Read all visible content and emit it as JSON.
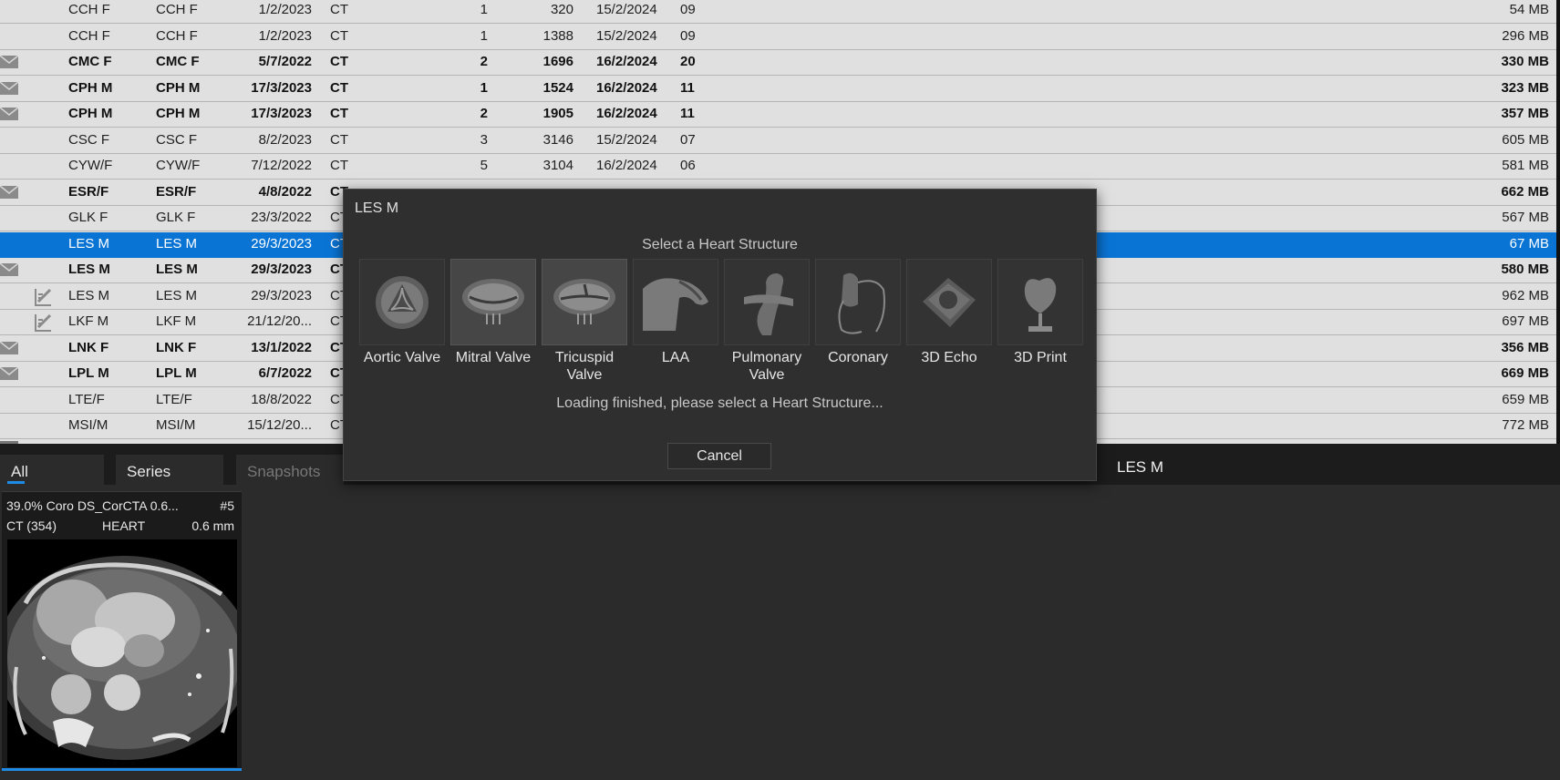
{
  "study_list": {
    "rows": [
      {
        "name": "CCH F",
        "name2": "CCH F",
        "date": "1/2/2023",
        "modality": "CT",
        "n1": "1",
        "n2": "320",
        "date2": "15/2/2024",
        "t": "09",
        "size": "54 MB",
        "bold": false,
        "icon": ""
      },
      {
        "name": "CCH F",
        "name2": "CCH F",
        "date": "1/2/2023",
        "modality": "CT",
        "n1": "1",
        "n2": "1388",
        "date2": "15/2/2024",
        "t": "09",
        "size": "296 MB",
        "bold": false,
        "icon": ""
      },
      {
        "name": "CMC F",
        "name2": "CMC F",
        "date": "5/7/2022",
        "modality": "CT",
        "n1": "2",
        "n2": "1696",
        "date2": "16/2/2024",
        "t": "20",
        "size": "330 MB",
        "bold": true,
        "icon": "envelope"
      },
      {
        "name": "CPH M",
        "name2": "CPH M",
        "date": "17/3/2023",
        "modality": "CT",
        "n1": "1",
        "n2": "1524",
        "date2": "16/2/2024",
        "t": "11",
        "size": "323 MB",
        "bold": true,
        "icon": "envelope"
      },
      {
        "name": "CPH M",
        "name2": "CPH M",
        "date": "17/3/2023",
        "modality": "CT",
        "n1": "2",
        "n2": "1905",
        "date2": "16/2/2024",
        "t": "11",
        "size": "357 MB",
        "bold": true,
        "icon": "envelope"
      },
      {
        "name": "CSC F",
        "name2": "CSC F",
        "date": "8/2/2023",
        "modality": "CT",
        "n1": "3",
        "n2": "3146",
        "date2": "15/2/2024",
        "t": "07",
        "size": "605 MB",
        "bold": false,
        "icon": ""
      },
      {
        "name": "CYW/F",
        "name2": "CYW/F",
        "date": "7/12/2022",
        "modality": "CT",
        "n1": "5",
        "n2": "3104",
        "date2": "16/2/2024",
        "t": "06",
        "size": "581 MB",
        "bold": false,
        "icon": ""
      },
      {
        "name": "ESR/F",
        "name2": "ESR/F",
        "date": "4/8/2022",
        "modality": "CT",
        "n1": "",
        "n2": "",
        "date2": "",
        "t": "",
        "size": "662 MB",
        "bold": true,
        "icon": "envelope"
      },
      {
        "name": "GLK F",
        "name2": "GLK F",
        "date": "23/3/2022",
        "modality": "CT",
        "n1": "",
        "n2": "",
        "date2": "",
        "t": "",
        "size": "567 MB",
        "bold": false,
        "icon": ""
      },
      {
        "name": "LES M",
        "name2": "LES M",
        "date": "29/3/2023",
        "modality": "CT",
        "n1": "",
        "n2": "",
        "date2": "",
        "t": "",
        "size": "67 MB",
        "bold": false,
        "icon": "",
        "selected": true
      },
      {
        "name": "LES M",
        "name2": "LES M",
        "date": "29/3/2023",
        "modality": "CT",
        "n1": "",
        "n2": "",
        "date2": "",
        "t": "",
        "size": "580 MB",
        "bold": true,
        "icon": "envelope"
      },
      {
        "name": "LES M",
        "name2": "LES M",
        "date": "29/3/2023",
        "modality": "CT",
        "n1": "",
        "n2": "",
        "date2": "",
        "t": "",
        "size": "962 MB",
        "bold": false,
        "icon": "report"
      },
      {
        "name": "LKF M",
        "name2": "LKF M",
        "date": "21/12/20...",
        "modality": "CT",
        "n1": "",
        "n2": "",
        "date2": "",
        "t": "",
        "size": "697 MB",
        "bold": false,
        "icon": "report"
      },
      {
        "name": "LNK F",
        "name2": "LNK F",
        "date": "13/1/2022",
        "modality": "CT",
        "n1": "",
        "n2": "",
        "date2": "",
        "t": "",
        "size": "356 MB",
        "bold": true,
        "icon": "envelope"
      },
      {
        "name": "LPL M",
        "name2": "LPL M",
        "date": "6/7/2022",
        "modality": "CT",
        "n1": "",
        "n2": "",
        "date2": "",
        "t": "",
        "size": "669 MB",
        "bold": true,
        "icon": "envelope"
      },
      {
        "name": "LTE/F",
        "name2": "LTE/F",
        "date": "18/8/2022",
        "modality": "CT",
        "n1": "",
        "n2": "",
        "date2": "",
        "t": "",
        "size": "659 MB",
        "bold": false,
        "icon": ""
      },
      {
        "name": "MSI/M",
        "name2": "MSI/M",
        "date": "15/12/20...",
        "modality": "CT",
        "n1": "",
        "n2": "",
        "date2": "",
        "t": "",
        "size": "772 MB",
        "bold": false,
        "icon": ""
      }
    ]
  },
  "tabs": {
    "all": "All",
    "series": "Series",
    "snapshots": "Snapshots"
  },
  "viewer": {
    "title": "LES M"
  },
  "thumbnail": {
    "line1": "39.0%  Coro DS_CorCTA 0.6...",
    "number": "#5",
    "modality": "CT (354)",
    "organ": "HEART",
    "thickness": "0.6 mm"
  },
  "dialog": {
    "title": "LES M",
    "heading": "Select a Heart Structure",
    "structures": [
      {
        "label": "Aortic Valve",
        "icon": "aortic-valve-icon"
      },
      {
        "label": "Mitral Valve",
        "icon": "mitral-valve-icon"
      },
      {
        "label": "Tricuspid Valve",
        "icon": "tricuspid-valve-icon"
      },
      {
        "label": "LAA",
        "icon": "laa-icon"
      },
      {
        "label": "Pulmonary Valve",
        "icon": "pulmonary-valve-icon"
      },
      {
        "label": "Coronary",
        "icon": "coronary-icon"
      },
      {
        "label": "3D Echo",
        "icon": "3d-echo-icon"
      },
      {
        "label": "3D Print",
        "icon": "3d-print-icon"
      }
    ],
    "status": "Loading finished, please select a Heart Structure...",
    "cancel": "Cancel"
  },
  "colors": {
    "selection": "#0a74d4",
    "accent": "#1e8be6",
    "dialog_bg": "#2f2f2f",
    "list_bg": "#e0e0e0"
  }
}
